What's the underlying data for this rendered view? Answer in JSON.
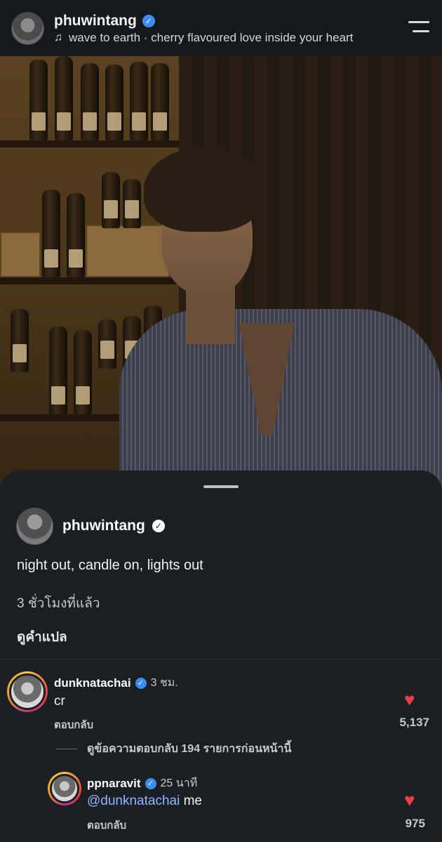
{
  "header": {
    "username": "phuwintang",
    "music": "wave to earth · cherry flavoured love inside your heart"
  },
  "post": {
    "username": "phuwintang",
    "caption": "night out, candle on, lights out",
    "time": "3 ชั่วโมงที่แล้ว",
    "translate_label": "ดูคำแปล"
  },
  "comments": [
    {
      "username": "dunknatachai",
      "time": "3 ชม.",
      "text": "cr",
      "reply_label": "ตอบกลับ",
      "likes": "5,137"
    }
  ],
  "view_replies_label": "ดูข้อความตอบกลับ 194 รายการก่อนหน้านี้",
  "reply": {
    "username": "ppnaravit",
    "time": "25 นาที",
    "mention": "@dunknatachai",
    "text": " me",
    "reply_label": "ตอบกลับ",
    "likes": "975"
  },
  "colors": {
    "background": "#1b1e22",
    "heart": "#ed3e45",
    "verified": "#3b8cf3",
    "mention": "#8fb6ff"
  }
}
